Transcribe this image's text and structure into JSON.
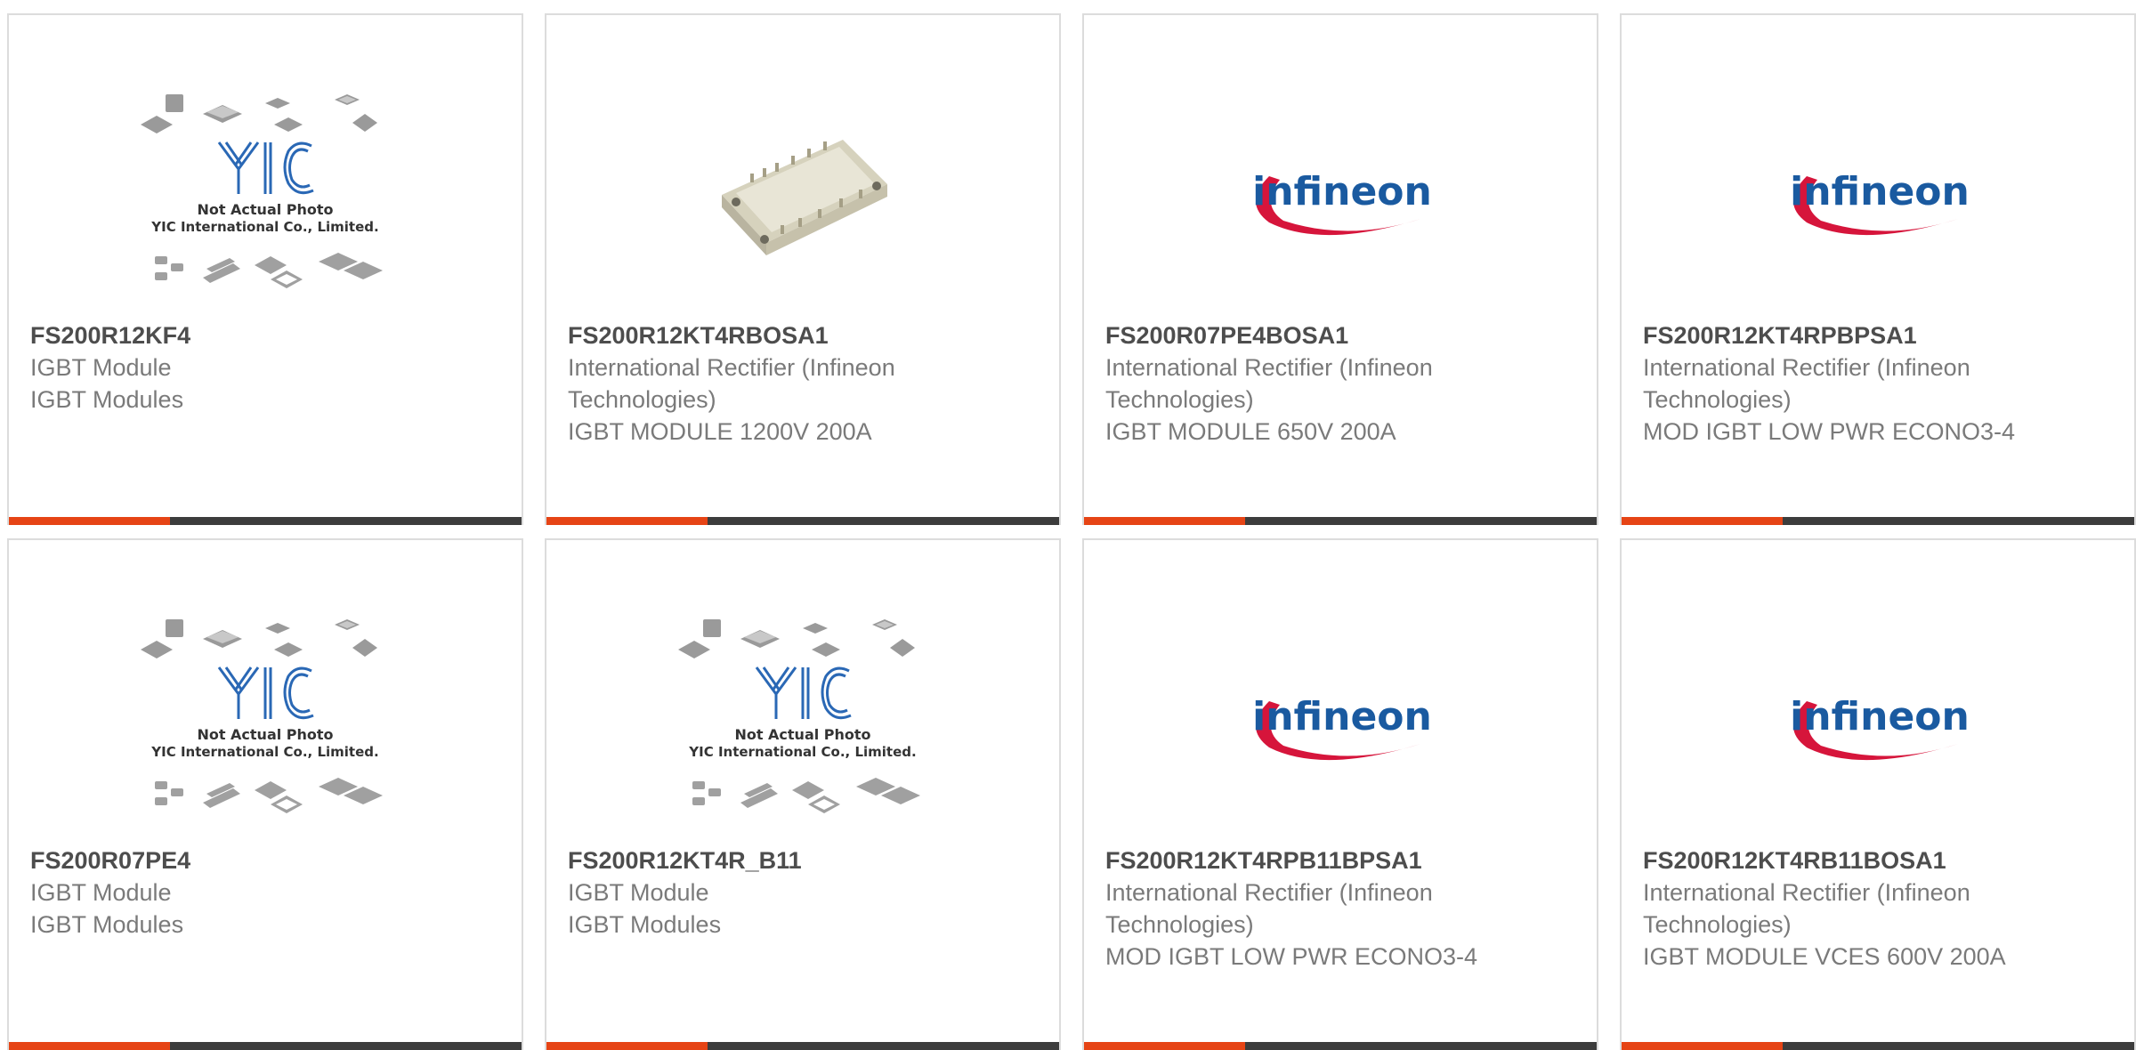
{
  "colors": {
    "accent": "#e64415",
    "bar_rest": "#3c3c3c",
    "logo_blue": "#1a5aa0",
    "logo_red": "#d6153b",
    "yic_blue": "#2a68b5"
  },
  "placeholder": {
    "caption_line1": "Not Actual Photo",
    "caption_line2": "YIC International Co., Limited.",
    "logo_text": "YIC"
  },
  "infineon_logo": {
    "text": "infineon"
  },
  "products": [
    {
      "image": "placeholder",
      "part_number": "FS200R12KF4",
      "manufacturer": "IGBT Module",
      "description": "IGBT Modules"
    },
    {
      "image": "module-photo",
      "part_number": "FS200R12KT4RBOSA1",
      "manufacturer": "International Rectifier (Infineon Technologies)",
      "description": "IGBT MODULE 1200V 200A"
    },
    {
      "image": "infineon-logo",
      "part_number": "FS200R07PE4BOSA1",
      "manufacturer": "International Rectifier (Infineon Technologies)",
      "description": "IGBT MODULE 650V 200A"
    },
    {
      "image": "infineon-logo",
      "part_number": "FS200R12KT4RPBPSA1",
      "manufacturer": "International Rectifier (Infineon Technologies)",
      "description": "MOD IGBT LOW PWR ECONO3-4"
    },
    {
      "image": "placeholder",
      "part_number": "FS200R07PE4",
      "manufacturer": "IGBT Module",
      "description": "IGBT Modules"
    },
    {
      "image": "placeholder",
      "part_number": "FS200R12KT4R_B11",
      "manufacturer": "IGBT Module",
      "description": "IGBT Modules"
    },
    {
      "image": "infineon-logo",
      "part_number": "FS200R12KT4RPB11BPSA1",
      "manufacturer": "International Rectifier (Infineon Technologies)",
      "description": "MOD IGBT LOW PWR ECONO3-4"
    },
    {
      "image": "infineon-logo",
      "part_number": "FS200R12KT4RB11BOSA1",
      "manufacturer": "International Rectifier (Infineon Technologies)",
      "description": "IGBT MODULE VCES 600V 200A"
    }
  ]
}
